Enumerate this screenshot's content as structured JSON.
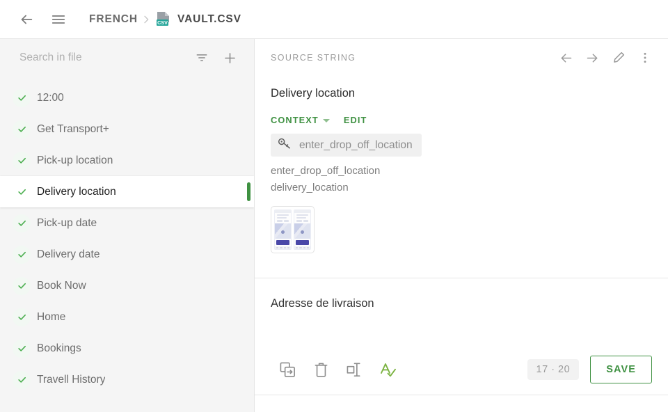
{
  "topbar": {
    "back_icon": "arrow-left-icon",
    "menu_icon": "hamburger-menu-icon",
    "project_name": "FRENCH",
    "separator": "›",
    "file_icon": "csv-file-icon",
    "file_badge_text": "CSV",
    "file_name": "VAULT.CSV"
  },
  "sidebar": {
    "search": {
      "placeholder": "Search in file",
      "value": ""
    },
    "filter_icon": "filter-icon",
    "add_icon": "plus-icon",
    "items": [
      {
        "label": "12:00",
        "status": "check-icon",
        "selected": false
      },
      {
        "label": "Get Transport+",
        "status": "check-icon",
        "selected": false
      },
      {
        "label": "Pick-up location",
        "status": "check-icon",
        "selected": false
      },
      {
        "label": "Delivery location",
        "status": "check-icon",
        "selected": true
      },
      {
        "label": "Pick-up date",
        "status": "check-icon",
        "selected": false
      },
      {
        "label": "Delivery date",
        "status": "check-icon",
        "selected": false
      },
      {
        "label": "Book Now",
        "status": "check-icon",
        "selected": false
      },
      {
        "label": "Home",
        "status": "check-icon",
        "selected": false
      },
      {
        "label": "Bookings",
        "status": "check-icon",
        "selected": false
      },
      {
        "label": "Travell History",
        "status": "check-icon",
        "selected": false
      }
    ]
  },
  "source_pane": {
    "title": "SOURCE STRING",
    "prev_icon": "arrow-left-icon",
    "next_icon": "arrow-right-icon",
    "edit_icon": "pencil-icon",
    "more_icon": "more-vertical-icon",
    "source_string": "Delivery location",
    "context_label": "CONTEXT",
    "context_caret_icon": "chevron-down-icon",
    "edit_label": "EDIT",
    "key_icon": "key-icon",
    "key_name": "enter_drop_off_location",
    "context_lines": [
      "enter_drop_off_location",
      "delivery_location"
    ],
    "screenshot_thumbnail": "app-screenshot-thumbnail"
  },
  "target_pane": {
    "translation": "Adresse de livraison",
    "actions": [
      {
        "icon": "copy-source-icon",
        "name": "copy-source-button"
      },
      {
        "icon": "trash-icon",
        "name": "delete-button"
      },
      {
        "icon": "split-segment-icon",
        "name": "split-segment-button"
      },
      {
        "icon": "spellcheck-icon",
        "name": "spellcheck-button"
      }
    ],
    "char_count": "17 · 20",
    "save_label": "SAVE"
  },
  "colors": {
    "accent_green": "#3f9142",
    "sidebar_bg": "#f5f5f5",
    "text_primary": "#2c2c2c",
    "text_muted": "#9a9a9a"
  }
}
